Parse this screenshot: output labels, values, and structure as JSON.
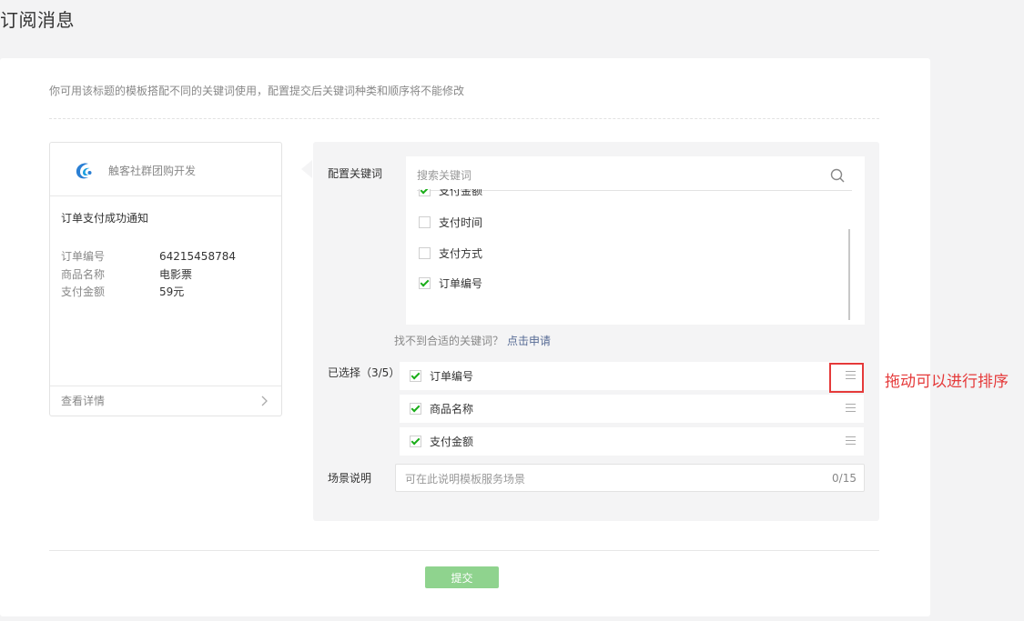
{
  "page": {
    "title": "订阅消息"
  },
  "hint": "你可用该标题的模板搭配不同的关键词使用，配置提交后关键词种类和顺序将不能修改",
  "preview": {
    "app_name": "触客社群团购开发",
    "message_title": "订单支付成功通知",
    "rows": [
      {
        "key": "订单编号",
        "value": "64215458784"
      },
      {
        "key": "商品名称",
        "value": "电影票"
      },
      {
        "key": "支付金额",
        "value": "59元"
      }
    ],
    "footer_link": "查看详情"
  },
  "config": {
    "keywords_label": "配置关键词",
    "search_placeholder": "搜索关键词",
    "keywords": [
      {
        "label": "支付金额",
        "checked": true
      },
      {
        "label": "支付时间",
        "checked": false
      },
      {
        "label": "支付方式",
        "checked": false
      },
      {
        "label": "订单编号",
        "checked": true
      }
    ],
    "not_found_text": "找不到合适的关键词？",
    "apply_link": "点击申请",
    "selected_label": "已选择（3/5）",
    "selected": [
      {
        "label": "订单编号",
        "checked": true
      },
      {
        "label": "商品名称",
        "checked": true
      },
      {
        "label": "支付金额",
        "checked": true
      }
    ],
    "scene_label": "场景说明",
    "scene_placeholder": "可在此说明模板服务场景",
    "scene_count": "0/15"
  },
  "annotation": "拖动可以进行排序",
  "submit_label": "提交",
  "colors": {
    "accent_green": "#1aad19",
    "link_blue": "#576b95",
    "annotation_red": "#e53a3a",
    "submit_disabled": "#8fd38e"
  }
}
